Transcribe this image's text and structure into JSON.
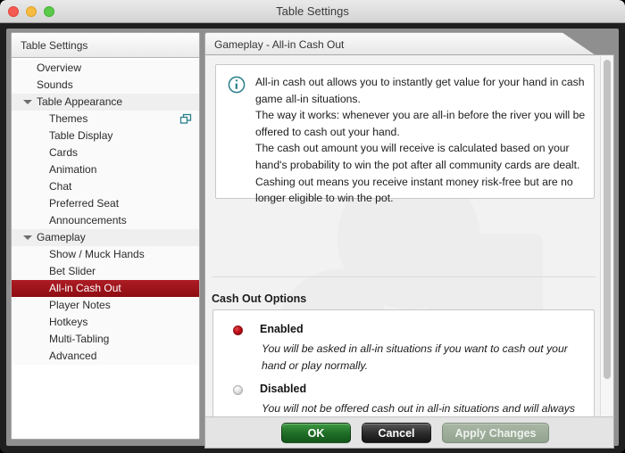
{
  "window": {
    "title": "Table Settings",
    "controls": [
      "close",
      "minimize",
      "zoom"
    ]
  },
  "sidebar": {
    "header": "Table Settings",
    "items": [
      {
        "label": "Overview",
        "level": "top",
        "expander": false,
        "selected": false,
        "badge": false
      },
      {
        "label": "Sounds",
        "level": "top",
        "expander": false,
        "selected": false,
        "badge": false
      },
      {
        "label": "Table Appearance",
        "level": "group",
        "expander": true,
        "selected": false,
        "badge": false
      },
      {
        "label": "Themes",
        "level": "child",
        "expander": false,
        "selected": false,
        "badge": true
      },
      {
        "label": "Table Display",
        "level": "child",
        "expander": false,
        "selected": false,
        "badge": false
      },
      {
        "label": "Cards",
        "level": "child",
        "expander": false,
        "selected": false,
        "badge": false
      },
      {
        "label": "Animation",
        "level": "child",
        "expander": false,
        "selected": false,
        "badge": false
      },
      {
        "label": "Chat",
        "level": "child",
        "expander": false,
        "selected": false,
        "badge": false
      },
      {
        "label": "Preferred Seat",
        "level": "child",
        "expander": false,
        "selected": false,
        "badge": false
      },
      {
        "label": "Announcements",
        "level": "child",
        "expander": false,
        "selected": false,
        "badge": false
      },
      {
        "label": "Gameplay",
        "level": "group",
        "expander": true,
        "selected": false,
        "badge": false
      },
      {
        "label": "Show / Muck Hands",
        "level": "child",
        "expander": false,
        "selected": false,
        "badge": false
      },
      {
        "label": "Bet Slider",
        "level": "child",
        "expander": false,
        "selected": false,
        "badge": false
      },
      {
        "label": "All-in Cash Out",
        "level": "child",
        "expander": false,
        "selected": true,
        "badge": false
      },
      {
        "label": "Player Notes",
        "level": "child",
        "expander": false,
        "selected": false,
        "badge": false
      },
      {
        "label": "Hotkeys",
        "level": "child",
        "expander": false,
        "selected": false,
        "badge": false
      },
      {
        "label": "Multi-Tabling",
        "level": "child",
        "expander": false,
        "selected": false,
        "badge": false
      },
      {
        "label": "Advanced",
        "level": "child",
        "expander": false,
        "selected": false,
        "badge": false
      }
    ]
  },
  "panel": {
    "tab_title": "Gameplay - All-in Cash Out",
    "info": {
      "icon": "info-icon",
      "paragraphs": [
        "All-in cash out allows you to instantly get value for your hand in cash game all-in situations.",
        "The way it works: whenever you are all-in before the river you will be offered to cash out your hand.",
        "The cash out amount you will receive is calculated based on your hand's probability to win the pot after all community cards are dealt.",
        "Cashing out means you receive instant money risk-free but are no longer eligible to win the pot."
      ]
    },
    "section_title": "Cash Out Options",
    "options": [
      {
        "label": "Enabled",
        "selected": true,
        "description": "You will be asked in all-in situations if you want to cash out your hand or play normally."
      },
      {
        "label": "Disabled",
        "selected": false,
        "description": "You will not be offered cash out in all-in situations and will always play your hand normally."
      }
    ]
  },
  "buttons": {
    "ok": "OK",
    "cancel": "Cancel",
    "apply": "Apply Changes",
    "apply_enabled": false
  },
  "colors": {
    "selection_red": "#9e1018",
    "accent_teal": "#2b7f8c",
    "ok_green": "#1f6e26",
    "cancel_black": "#2c2c2c",
    "apply_disabled": "#92a38f"
  }
}
